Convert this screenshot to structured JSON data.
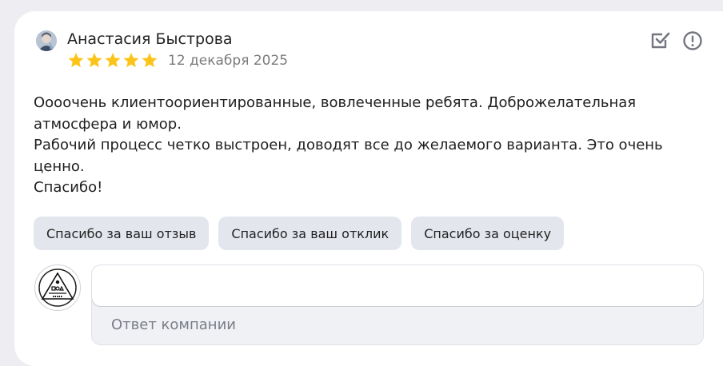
{
  "review": {
    "author": "Анастасия Быстрова",
    "rating": 5,
    "rating_max": 5,
    "date": "12 декабря 2025",
    "star_color": "#fcc419",
    "text_lines": [
      "Оооочень клиентоориентированные, вовлеченные ребята. Доброжелательная",
      "атмосфера и юмор.",
      "Рабочий процесс четко выстроен, доводят все до желаемого варианта. Это очень",
      "ценно.",
      "Спасибо!"
    ]
  },
  "actions": {
    "mark_icon": "checkbox-check-icon",
    "report_icon": "exclamation-circle-icon"
  },
  "quick_replies": [
    "Спасибо за ваш отзыв",
    "Спасибо за ваш отклик",
    "Спасибо за оценку"
  ],
  "reply": {
    "input_value": "",
    "label": "Ответ компании"
  }
}
